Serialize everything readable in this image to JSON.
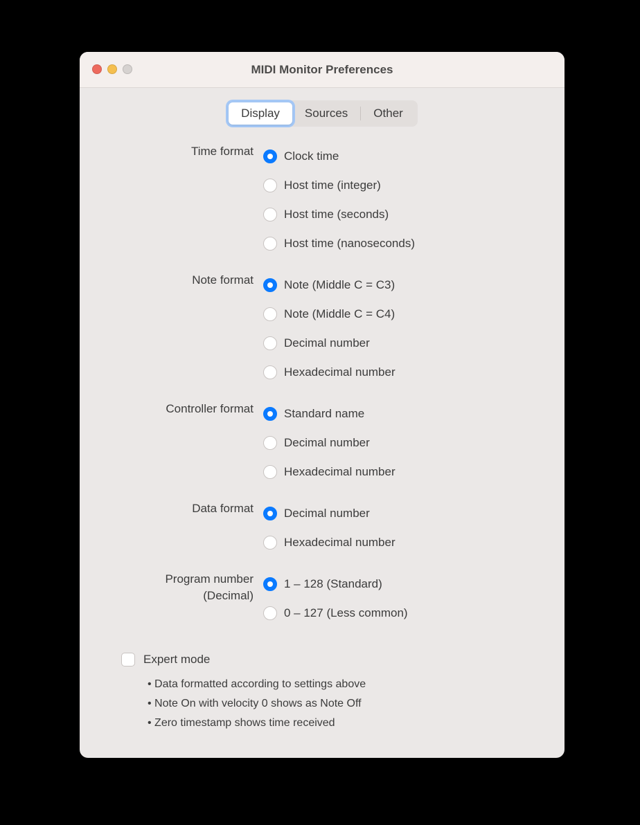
{
  "window": {
    "title": "MIDI Monitor Preferences"
  },
  "tabs": {
    "items": [
      {
        "label": "Display",
        "active": true
      },
      {
        "label": "Sources",
        "active": false
      },
      {
        "label": "Other",
        "active": false
      }
    ]
  },
  "sections": {
    "time_format": {
      "label": "Time format",
      "options": [
        {
          "label": "Clock time",
          "checked": true
        },
        {
          "label": "Host time (integer)",
          "checked": false
        },
        {
          "label": "Host time (seconds)",
          "checked": false
        },
        {
          "label": "Host time (nanoseconds)",
          "checked": false
        }
      ]
    },
    "note_format": {
      "label": "Note format",
      "options": [
        {
          "label": "Note (Middle C = C3)",
          "checked": true
        },
        {
          "label": "Note (Middle C = C4)",
          "checked": false
        },
        {
          "label": "Decimal number",
          "checked": false
        },
        {
          "label": "Hexadecimal number",
          "checked": false
        }
      ]
    },
    "controller_format": {
      "label": "Controller format",
      "options": [
        {
          "label": "Standard name",
          "checked": true
        },
        {
          "label": "Decimal number",
          "checked": false
        },
        {
          "label": "Hexadecimal number",
          "checked": false
        }
      ]
    },
    "data_format": {
      "label": "Data format",
      "options": [
        {
          "label": "Decimal number",
          "checked": true
        },
        {
          "label": "Hexadecimal number",
          "checked": false
        }
      ]
    },
    "program_number": {
      "label_line1": "Program number",
      "label_line2": "(Decimal)",
      "options": [
        {
          "label": "1 – 128 (Standard)",
          "checked": true
        },
        {
          "label": "0 – 127 (Less common)",
          "checked": false
        }
      ]
    }
  },
  "expert": {
    "label": "Expert mode",
    "checked": false,
    "bullets": [
      "Data formatted according to settings above",
      "Note On with velocity 0 shows as Note Off",
      "Zero timestamp shows time received"
    ]
  }
}
